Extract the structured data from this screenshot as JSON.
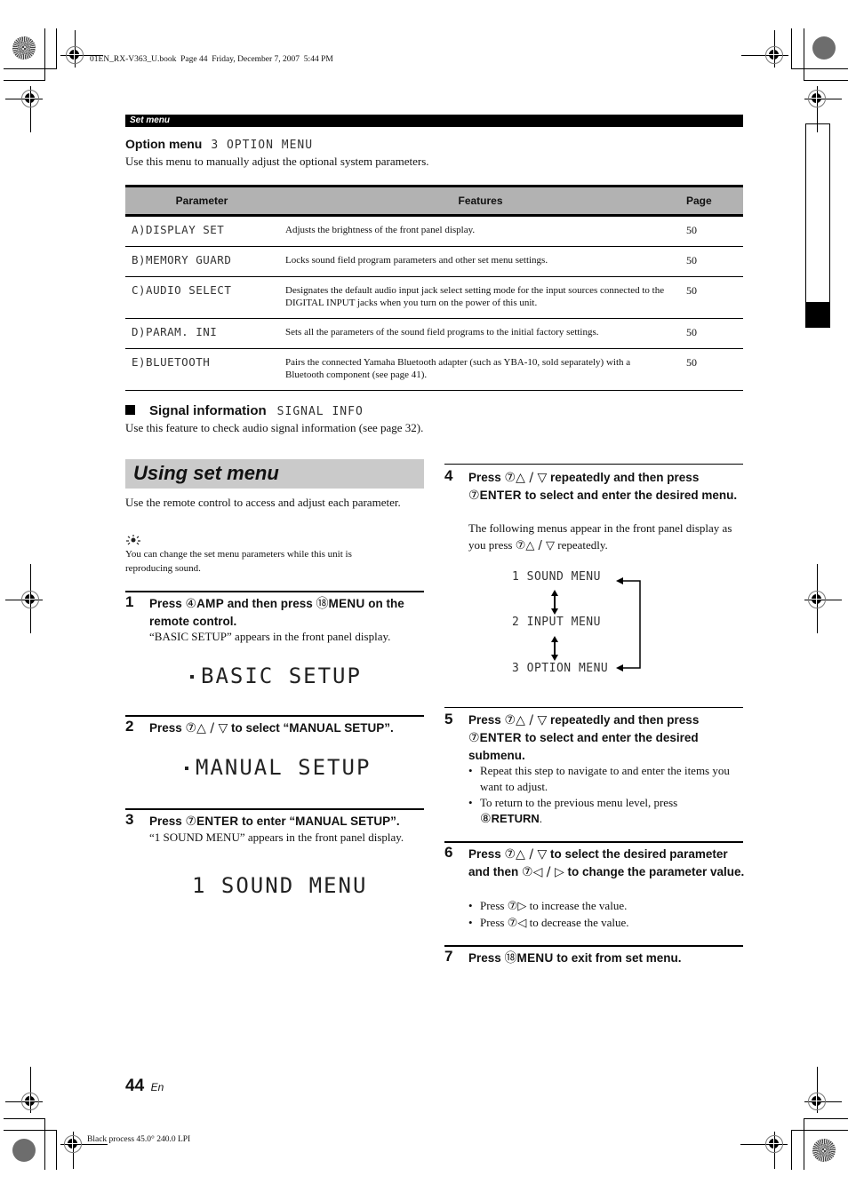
{
  "print_info": {
    "top_slug": "01EN_RX-V363_U.book  Page 44  Friday, December 7, 2007  5:44 PM",
    "bottom_slug": "Black process 45.0° 240.0 LPI"
  },
  "header_bar": "Set menu",
  "option_menu": {
    "title": "Option menu",
    "display_label": "3 OPTION MENU",
    "description": "Use this menu to manually adjust the optional system parameters."
  },
  "table": {
    "headers": [
      "Parameter",
      "Features",
      "Page"
    ],
    "rows": [
      {
        "parameter": "A)DISPLAY SET",
        "feature": "Adjusts the brightness of the front panel display.",
        "page": "50"
      },
      {
        "parameter": "B)MEMORY GUARD",
        "feature": "Locks sound field program parameters and other set menu settings.",
        "page": "50"
      },
      {
        "parameter": "C)AUDIO SELECT",
        "feature": "Designates the default audio input jack select setting mode for the input sources connected to the DIGITAL INPUT jacks when you turn on the power of this unit.",
        "page": "50"
      },
      {
        "parameter": "D)PARAM. INI",
        "feature": "Sets all the parameters of the sound field programs to the initial factory settings.",
        "page": "50"
      },
      {
        "parameter": "E)BLUETOOTH",
        "feature": "Pairs the connected Yamaha Bluetooth adapter (such as YBA-10, sold separately) with a Bluetooth component (see page 41).",
        "page": "50"
      }
    ]
  },
  "signal_info": {
    "title": "Signal information",
    "display_label": "SIGNAL INFO",
    "description": "Use this feature to check audio signal information (see page 32)."
  },
  "using": {
    "title": "Using set menu",
    "intro": "Use the remote control to access and adjust each parameter.",
    "tip_icon": "lightbulb-tip-icon",
    "tip": "You can change the set menu parameters while this unit is reproducing sound."
  },
  "steps": [
    {
      "num": "1",
      "parts": [
        "Press ",
        "④",
        "AMP",
        " and then press ",
        "⑱",
        "MENU",
        " on the remote control."
      ],
      "body": "“BASIC SETUP” appears in the front panel display.",
      "display": "BASIC SETUP"
    },
    {
      "num": "2",
      "parts": [
        "Press ",
        "⑦",
        "△ / ▽",
        " to select “MANUAL SETUP”."
      ],
      "display": "MANUAL SETUP"
    },
    {
      "num": "3",
      "parts": [
        "Press ",
        "⑦",
        "ENTER",
        " to enter “MANUAL SETUP”."
      ],
      "body": "“1 SOUND MENU” appears in the front panel display.",
      "display": "1 SOUND MENU"
    },
    {
      "num": "4",
      "parts": [
        "Press ",
        "⑦",
        "△ / ▽",
        " repeatedly and then press ",
        "⑦",
        "ENTER",
        " to select and enter the desired menu."
      ],
      "body_pre": "The following menus appear in the front panel display as you press ",
      "body_key": "⑦△ / ▽",
      "body_post": " repeatedly.",
      "menus": [
        "1 SOUND MENU",
        "2 INPUT MENU",
        "3 OPTION MENU"
      ]
    },
    {
      "num": "5",
      "parts": [
        "Press ",
        "⑦",
        "△ / ▽",
        " repeatedly and then press ",
        "⑦",
        "ENTER",
        " to select and enter the desired submenu."
      ],
      "bullets": [
        "Repeat this step to navigate to and enter the items you want to adjust.",
        "To return to the previous menu level, press "
      ],
      "bullet2_circ": "⑧",
      "bullet2_key": "RETURN",
      "bullet2_end": "."
    },
    {
      "num": "6",
      "parts": [
        "Press ",
        "⑦",
        "△ / ▽",
        " to select the desired parameter and then ",
        "⑦",
        "◁ / ▷",
        " to change the parameter value."
      ],
      "bullet1_pre": "Press ",
      "bullet1_key": "⑦▷",
      "bullet1_post": " to increase the value.",
      "bullet2_pre": "Press ",
      "bullet2_key": "⑦◁",
      "bullet2_post": " to decrease the value."
    },
    {
      "num": "7",
      "parts": [
        "Press ",
        "⑱",
        "MENU",
        " to exit from set menu."
      ]
    }
  ],
  "footer": {
    "page_number": "44",
    "language": "En"
  }
}
